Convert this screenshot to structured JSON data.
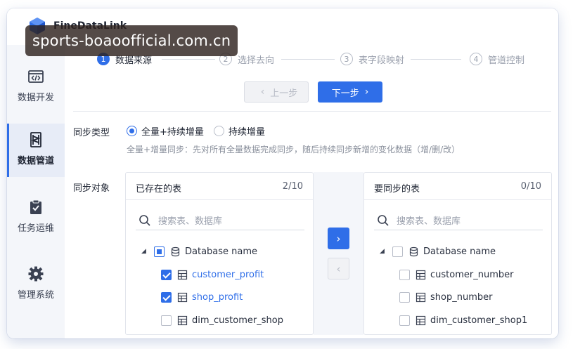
{
  "brand": {
    "name": "FineDataLink"
  },
  "watermark": {
    "text": "sports-boaoofficial.com.cn"
  },
  "sidebar": {
    "items": [
      {
        "label": "数据开发",
        "icon": "code-window-icon",
        "active": false
      },
      {
        "label": "数据管道",
        "icon": "pipeline-icon",
        "active": true
      },
      {
        "label": "任务运维",
        "icon": "clipboard-check-icon",
        "active": false
      },
      {
        "label": "管理系统",
        "icon": "gear-icon",
        "active": false
      }
    ]
  },
  "steps": [
    {
      "num": "1",
      "label": "数据来源",
      "active": true
    },
    {
      "num": "2",
      "label": "选择去向",
      "active": false
    },
    {
      "num": "3",
      "label": "表字段映射",
      "active": false
    },
    {
      "num": "4",
      "label": "管道控制",
      "active": false
    }
  ],
  "buttons": {
    "prev": "上一步",
    "next": "下一步"
  },
  "sync_type": {
    "label": "同步类型",
    "options": [
      {
        "label": "全量+持续增量",
        "checked": true
      },
      {
        "label": "持续增量",
        "checked": false
      }
    ],
    "hint": "全量+增量同步：先对所有全量数据完成同步，随后持续同步新增的变化数据（增/删/改）"
  },
  "sync_object": {
    "label": "同步对象"
  },
  "left_panel": {
    "title": "已存在的表",
    "count": "2/10",
    "search_placeholder": "搜索表、数据库",
    "database": "Database name",
    "tables": [
      {
        "name": "customer_profit",
        "checked": true
      },
      {
        "name": "shop_profit",
        "checked": true
      },
      {
        "name": "dim_customer_shop",
        "checked": false
      }
    ]
  },
  "right_panel": {
    "title": "要同步的表",
    "count": "0/10",
    "search_placeholder": "搜索表、数据库",
    "database": "Database name",
    "tables": [
      {
        "name": "customer_number",
        "checked": false
      },
      {
        "name": "shop_number",
        "checked": false
      },
      {
        "name": "dim_customer_shop1",
        "checked": false
      }
    ]
  },
  "colors": {
    "accent": "#2f6ee8",
    "sidebar_bg": "#f4f6fa",
    "text": "#1f2533"
  }
}
